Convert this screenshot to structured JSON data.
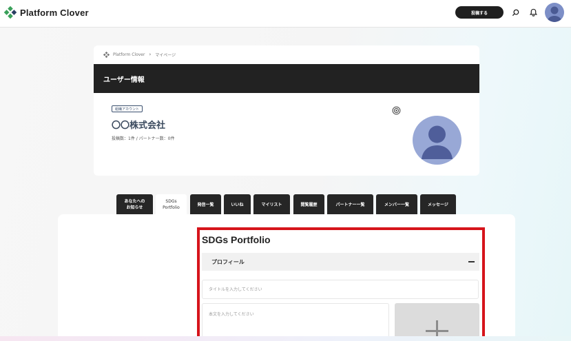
{
  "header": {
    "logo_text": "Platform Clover",
    "post_button": "投稿する",
    "icons": [
      "search-icon",
      "bell-icon",
      "user-avatar"
    ]
  },
  "breadcrumb": {
    "home": "Platform Clover",
    "current": "マイページ"
  },
  "user_info": {
    "heading": "ユーザー情報",
    "account_type": "組織アカウント",
    "name": "〇〇株式会社",
    "stats": "投稿数：1件 / パートナー数：0件"
  },
  "tabs": [
    {
      "label": "あなたへの\nお知らせ",
      "active": false
    },
    {
      "label": "SDGs\nPortfolio",
      "active": true
    },
    {
      "label": "発信一覧",
      "active": false
    },
    {
      "label": "いいね",
      "active": false
    },
    {
      "label": "マイリスト",
      "active": false
    },
    {
      "label": "閲覧履歴",
      "active": false
    },
    {
      "label": "パートナー一覧",
      "active": false
    },
    {
      "label": "メンバー一覧",
      "active": false
    },
    {
      "label": "メッセージ",
      "active": false
    }
  ],
  "portfolio": {
    "title": "SDGs Portfolio",
    "section": "プロフィール",
    "title_placeholder": "タイトルを入力してください",
    "body_placeholder": "本文を入力してください"
  },
  "colors": {
    "dark": "#222222",
    "highlight": "#d6141b",
    "avatar": "#98a8d6",
    "logo_green": "#3aa05a",
    "logo_navy": "#2b3f63"
  }
}
